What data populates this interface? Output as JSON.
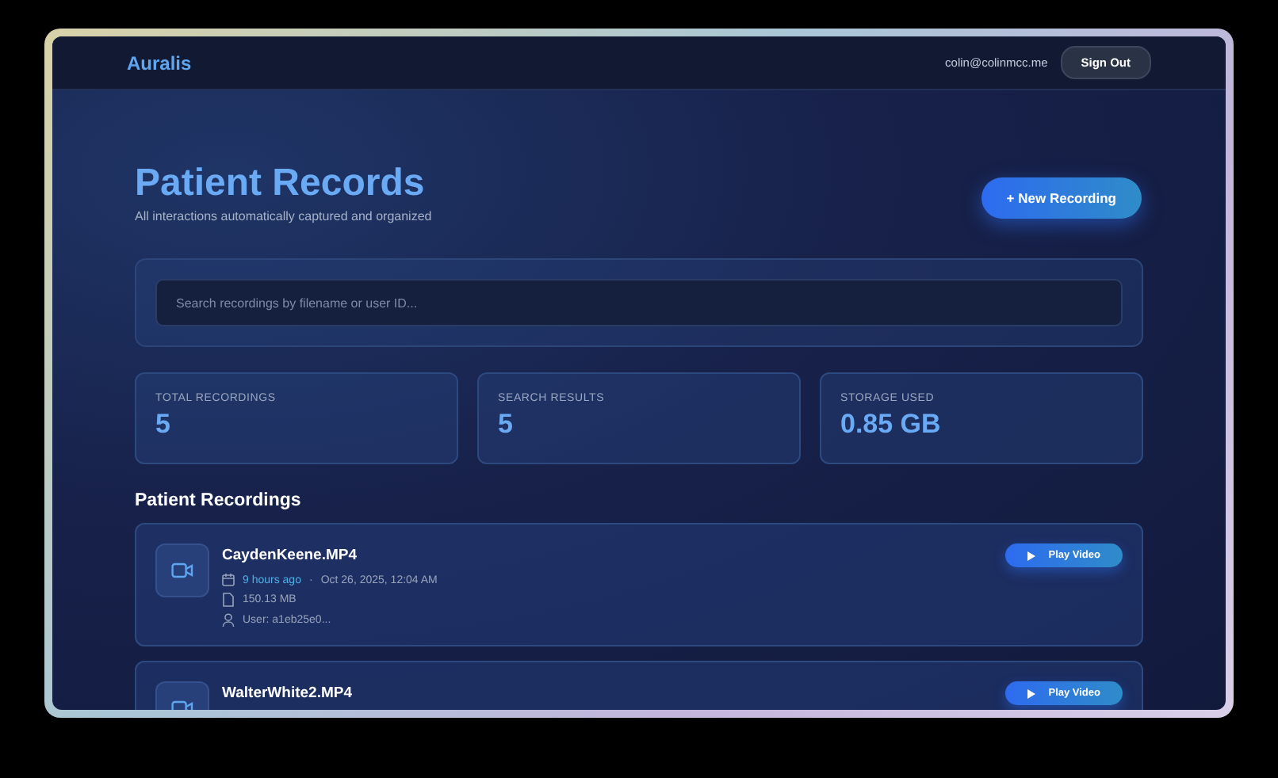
{
  "header": {
    "logo": "Auralis",
    "email": "colin@colinmcc.me",
    "sign_out": "Sign Out"
  },
  "page": {
    "title": "Patient Records",
    "subtitle": "All interactions automatically captured and organized",
    "new_button": "+ New Recording"
  },
  "search": {
    "placeholder": "Search recordings by filename or user ID..."
  },
  "stats": [
    {
      "label": "TOTAL RECORDINGS",
      "value": "5"
    },
    {
      "label": "SEARCH RESULTS",
      "value": "5"
    },
    {
      "label": "STORAGE USED",
      "value": "0.85 GB"
    }
  ],
  "section_title": "Patient Recordings",
  "recordings": [
    {
      "filename": "CaydenKeene.MP4",
      "relative_time": "9 hours ago",
      "separator": "·",
      "date": "Oct 26, 2025, 12:04 AM",
      "size": "150.13 MB",
      "user": "User: a1eb25e0...",
      "play": "Play Video"
    },
    {
      "filename": "WalterWhite2.MP4",
      "play": "Play Video"
    }
  ]
}
